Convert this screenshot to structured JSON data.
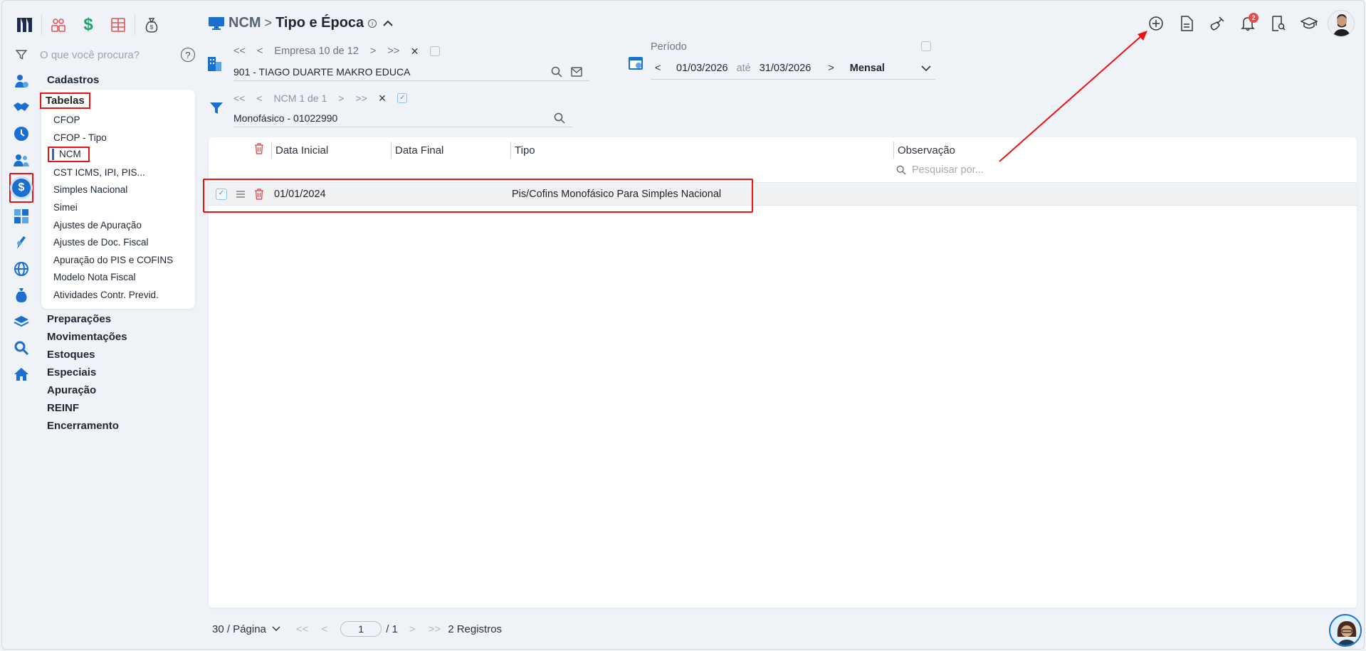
{
  "topbar": {
    "icons": [
      "logo-icon",
      "people-icon",
      "dollar-icon",
      "grid-icon",
      "money-bag-icon"
    ]
  },
  "search": {
    "placeholder": "O que você procura?",
    "help": "?"
  },
  "sidebar_icons": [
    "user-icon",
    "handshake-icon",
    "clock-icon",
    "team-icon",
    "dollar-circle-icon",
    "calculator-icon",
    "pen-icon",
    "globe-icon",
    "money-bag-icon",
    "layers-icon",
    "magnifier-icon",
    "home-icon"
  ],
  "menu": {
    "cadastros": "Cadastros",
    "tabelas": "Tabelas",
    "tabelas_items": [
      "CFOP",
      "CFOP - Tipo",
      "NCM",
      "CST ICMS, IPI, PIS...",
      "Simples Nacional",
      "Simei",
      "Ajustes de Apuração",
      "Ajustes de Doc. Fiscal",
      "Apuração do PIS e COFINS",
      "Modelo Nota Fiscal",
      "Atividades Contr. Previd."
    ],
    "sections": [
      "Preparações",
      "Movimentações",
      "Estoques",
      "Especiais",
      "Apuração",
      "REINF",
      "Encerramento"
    ]
  },
  "breadcrumb": {
    "parent": "NCM",
    "sep": ">",
    "current": "Tipo e Época",
    "info": "i"
  },
  "empresa": {
    "first": "<<",
    "prev": "<",
    "label": "Empresa 10 de 12",
    "next": ">",
    "last": ">>",
    "clear": "×",
    "value": "901 - TIAGO DUARTE MAKRO EDUCA"
  },
  "periodo": {
    "label": "Período",
    "prev": "<",
    "start": "01/03/2026",
    "ate": "até",
    "end": "31/03/2026",
    "next": ">",
    "mode": "Mensal"
  },
  "ncm_filter": {
    "first": "<<",
    "prev": "<",
    "label": "NCM 1 de 1",
    "next": ">",
    "last": ">>",
    "clear": "×",
    "value": "Monofásico  - 01022990"
  },
  "table": {
    "columns": [
      "Data Inicial",
      "Data Final",
      "Tipo",
      "Observação"
    ],
    "search_placeholder": "Pesquisar por...",
    "rows": [
      {
        "data_inicial": "01/01/2024",
        "data_final": "",
        "tipo": "Pis/Cofins Monofásico Para Simples Nacional",
        "observacao": ""
      }
    ]
  },
  "toolbar": {
    "notification_count": "2"
  },
  "pagination": {
    "per_page": "30 / Página",
    "first": "<<",
    "prev": "<",
    "page": "1",
    "total_pages": "/ 1",
    "next": ">",
    "last": ">>",
    "records": "2 Registros"
  },
  "colors": {
    "accent": "#1a6fd1",
    "highlight": "#e11111",
    "danger": "#e05555"
  }
}
